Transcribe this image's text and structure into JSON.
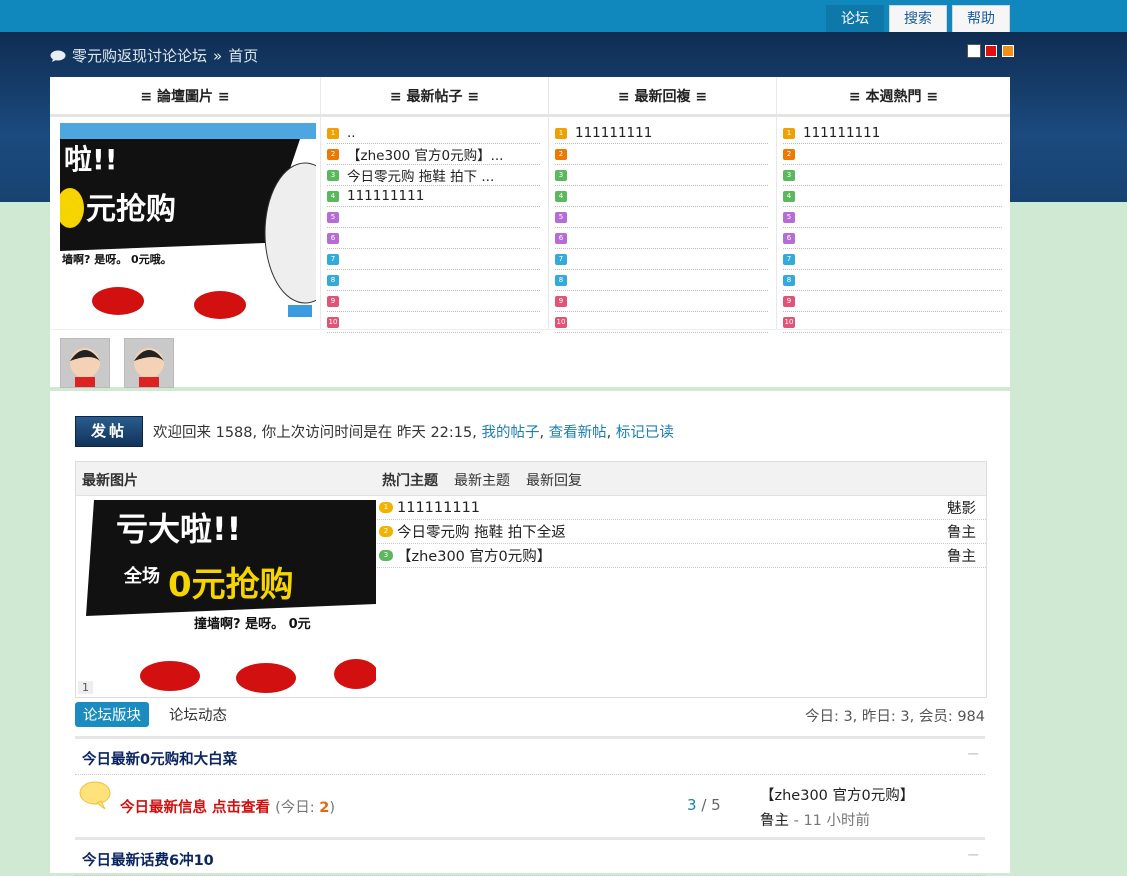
{
  "nav": {
    "tabs": [
      {
        "label": "论坛",
        "active": true
      },
      {
        "label": "搜索",
        "active": false
      },
      {
        "label": "帮助",
        "active": false
      }
    ],
    "breadcrumb": {
      "site": "零元购返现讨论论坛",
      "sep": "»",
      "page": "首页"
    },
    "swatch_colors": [
      "#ffffff",
      "#e01010",
      "#f09018"
    ]
  },
  "portal": {
    "headers": [
      "≡ 論壇圖片 ≡",
      "≡ 最新帖子 ≡",
      "≡ 最新回複 ≡",
      "≡ 本週熱門 ≡"
    ],
    "picture": {
      "caption_top": "啦!!",
      "caption_mid": "元抢购",
      "caption_low": "墙啊? 是呀。 0元哦。"
    },
    "latest_posts": [
      "..",
      "【zhe300 官方0元购】...",
      "今日零元购 拖鞋 拍下 ...",
      "111111111",
      "",
      "",
      "",
      "",
      "",
      ""
    ],
    "latest_replies": [
      "111111111",
      "",
      "",
      "",
      "",
      "",
      "",
      "",
      "",
      ""
    ],
    "weekly_hot": [
      "111111111",
      "",
      "",
      "",
      "",
      "",
      "",
      "",
      "",
      ""
    ],
    "rank_colors": [
      "#f0a000",
      "#f07800",
      "#5cb85c",
      "#5cb85c",
      "#b46cd6",
      "#b46cd6",
      "#34aadc",
      "#34aadc",
      "#e05577",
      "#e05577"
    ]
  },
  "main": {
    "post_button": "发帖",
    "welcome_text": "欢迎回来 1588, 你上次访问时间是在 昨天 22:15,",
    "welcome_links": [
      "我的帖子",
      "查看新帖",
      "标记已读"
    ],
    "box": {
      "title": "最新图片",
      "tabs": [
        "热门主题",
        "最新主题",
        "最新回复"
      ],
      "pic_index": "1",
      "pic_text_big": "亏大啦!!",
      "pic_text_side": "全场",
      "pic_text_main": "0元抢购",
      "pic_text_low": "撞墙啊? 是呀。 0元",
      "threads": [
        {
          "title": "111111111",
          "author": "魅影",
          "icon_color": "#f0b400"
        },
        {
          "title": "今日零元购 拖鞋 拍下全返",
          "author": "鲁主",
          "icon_color": "#f0b400"
        },
        {
          "title": "【zhe300 官方0元购】",
          "author": "鲁主",
          "icon_color": "#5cb85c"
        }
      ]
    },
    "forum_tabs": [
      "论坛版块",
      "论坛动态"
    ],
    "stats": "今日: 3, 昨日: 3, 会员: 984",
    "sections": [
      {
        "title": "今日最新0元购和大白菜",
        "collapse": "−"
      },
      {
        "title": "今日最新话费6冲10",
        "collapse": "−"
      }
    ],
    "forum": {
      "name": "今日最新信息 点击查看",
      "today_label": "(今日:",
      "today_count": "2",
      "today_close": ")",
      "threads": "3",
      "slash": "/",
      "posts": "5",
      "last_title": "【zhe300 官方0元购】",
      "last_user": "鲁主",
      "last_sep": "-",
      "last_time": "11 小时前"
    }
  }
}
